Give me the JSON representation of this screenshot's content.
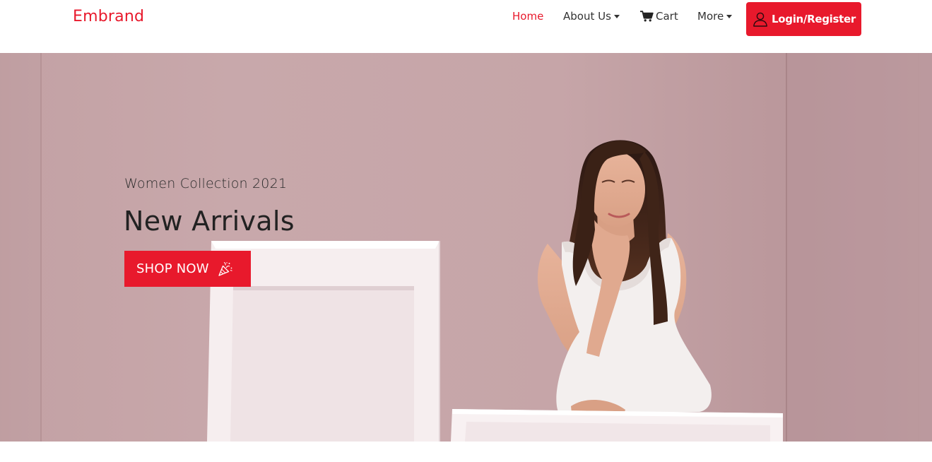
{
  "brand": {
    "name": "Embrand",
    "color": "#e8192c"
  },
  "nav": {
    "home": "Home",
    "about": "About Us",
    "cart": "Cart",
    "more": "More",
    "active_item": "home",
    "icons": {
      "cart": "cart-icon",
      "dropdown": "caret-down-icon"
    }
  },
  "login": {
    "label": "Login/Register",
    "icon": "user-icon",
    "color": "#e8192c"
  },
  "hero": {
    "subtitle": "Women Collection 2021",
    "title": "New Arrivals",
    "cta_label": "SHOP NOW",
    "cta_icon": "party-popper-icon",
    "background_color": "#c6a5a8",
    "accent_color": "#e8192c"
  }
}
